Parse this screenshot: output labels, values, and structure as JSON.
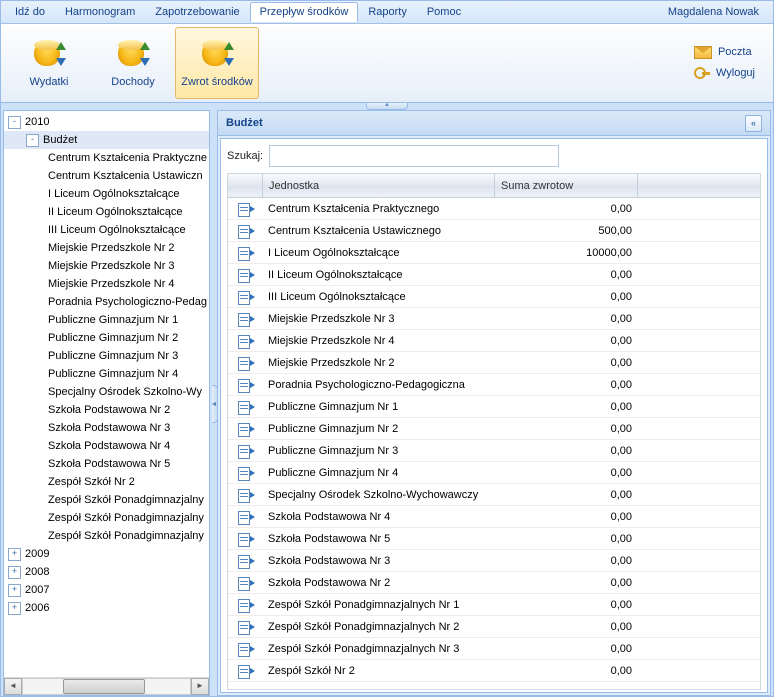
{
  "menubar": {
    "items": [
      {
        "label": "Idź do"
      },
      {
        "label": "Harmonogram"
      },
      {
        "label": "Zapotrzebowanie"
      },
      {
        "label": "Przepływ środków",
        "active": true
      },
      {
        "label": "Raporty"
      },
      {
        "label": "Pomoc"
      }
    ],
    "user": "Magdalena Nowak"
  },
  "ribbon": {
    "buttons": [
      {
        "label": "Wydatki",
        "icon": "db-refund"
      },
      {
        "label": "Dochody",
        "icon": "db-refund"
      },
      {
        "label": "Zwrot środków",
        "icon": "db-refund",
        "selected": true
      }
    ],
    "links": [
      {
        "label": "Poczta",
        "icon": "mail-icon"
      },
      {
        "label": "Wyloguj",
        "icon": "key-icon"
      }
    ]
  },
  "tree": {
    "nodes": [
      {
        "level": 1,
        "expanded": true,
        "label": "2010",
        "toggle": "-"
      },
      {
        "level": 2,
        "expanded": true,
        "label": "Budżet",
        "toggle": "-",
        "selected": true
      },
      {
        "level": 3,
        "label": "Centrum Kształcenia Praktyczne"
      },
      {
        "level": 3,
        "label": "Centrum Kształcenia Ustawiczn"
      },
      {
        "level": 3,
        "label": "I Liceum Ogólnokształcące"
      },
      {
        "level": 3,
        "label": "II Liceum Ogólnokształcące"
      },
      {
        "level": 3,
        "label": "III Liceum Ogólnokształcące"
      },
      {
        "level": 3,
        "label": "Miejskie Przedszkole Nr 2"
      },
      {
        "level": 3,
        "label": "Miejskie Przedszkole Nr 3"
      },
      {
        "level": 3,
        "label": "Miejskie Przedszkole Nr 4"
      },
      {
        "level": 3,
        "label": "Poradnia Psychologiczno-Pedag"
      },
      {
        "level": 3,
        "label": "Publiczne Gimnazjum Nr 1"
      },
      {
        "level": 3,
        "label": "Publiczne Gimnazjum Nr 2"
      },
      {
        "level": 3,
        "label": "Publiczne Gimnazjum Nr 3"
      },
      {
        "level": 3,
        "label": "Publiczne Gimnazjum Nr 4"
      },
      {
        "level": 3,
        "label": "Specjalny Ośrodek Szkolno-Wy"
      },
      {
        "level": 3,
        "label": "Szkoła Podstawowa Nr 2"
      },
      {
        "level": 3,
        "label": "Szkoła Podstawowa Nr 3"
      },
      {
        "level": 3,
        "label": "Szkoła Podstawowa Nr 4"
      },
      {
        "level": 3,
        "label": "Szkoła Podstawowa Nr 5"
      },
      {
        "level": 3,
        "label": "Zespół Szkół Nr 2"
      },
      {
        "level": 3,
        "label": "Zespół Szkół Ponadgimnazjalny"
      },
      {
        "level": 3,
        "label": "Zespół Szkół Ponadgimnazjalny"
      },
      {
        "level": 3,
        "label": "Zespół Szkół Ponadgimnazjalny"
      },
      {
        "level": 1,
        "expanded": false,
        "label": "2009",
        "toggle": "+"
      },
      {
        "level": 1,
        "expanded": false,
        "label": "2008",
        "toggle": "+"
      },
      {
        "level": 1,
        "expanded": false,
        "label": "2007",
        "toggle": "+"
      },
      {
        "level": 1,
        "expanded": false,
        "label": "2006",
        "toggle": "+"
      }
    ]
  },
  "main": {
    "title": "Budżet",
    "search_label": "Szukaj:",
    "search_value": "",
    "columns": {
      "c1": "Jednostka",
      "c2": "Suma zwrotow",
      "c3": ""
    },
    "rows": [
      {
        "name": "Centrum Kształcenia Praktycznego",
        "val": "0,00"
      },
      {
        "name": "Centrum Kształcenia Ustawicznego",
        "val": "500,00"
      },
      {
        "name": "I Liceum Ogólnokształcące",
        "val": "10000,00"
      },
      {
        "name": "II Liceum Ogólnokształcące",
        "val": "0,00"
      },
      {
        "name": "III Liceum Ogólnokształcące",
        "val": "0,00"
      },
      {
        "name": "Miejskie Przedszkole Nr 3",
        "val": "0,00"
      },
      {
        "name": "Miejskie Przedszkole Nr 4",
        "val": "0,00"
      },
      {
        "name": "Miejskie Przedszkole Nr 2",
        "val": "0,00"
      },
      {
        "name": "Poradnia Psychologiczno-Pedagogiczna",
        "val": "0,00"
      },
      {
        "name": "Publiczne Gimnazjum Nr 1",
        "val": "0,00"
      },
      {
        "name": "Publiczne Gimnazjum Nr 2",
        "val": "0,00"
      },
      {
        "name": "Publiczne Gimnazjum Nr 3",
        "val": "0,00"
      },
      {
        "name": "Publiczne Gimnazjum Nr 4",
        "val": "0,00"
      },
      {
        "name": "Specjalny Ośrodek Szkolno-Wychowawczy",
        "val": "0,00"
      },
      {
        "name": "Szkoła Podstawowa Nr 4",
        "val": "0,00"
      },
      {
        "name": "Szkoła Podstawowa Nr 5",
        "val": "0,00"
      },
      {
        "name": "Szkoła Podstawowa Nr 3",
        "val": "0,00"
      },
      {
        "name": "Szkoła Podstawowa Nr 2",
        "val": "0,00"
      },
      {
        "name": "Zespół Szkół Ponadgimnazjalnych Nr 1",
        "val": "0,00"
      },
      {
        "name": "Zespół Szkół Ponadgimnazjalnych Nr 2",
        "val": "0,00"
      },
      {
        "name": "Zespół Szkół Ponadgimnazjalnych Nr 3",
        "val": "0,00"
      },
      {
        "name": "Zespół Szkół Nr 2",
        "val": "0,00"
      }
    ]
  }
}
